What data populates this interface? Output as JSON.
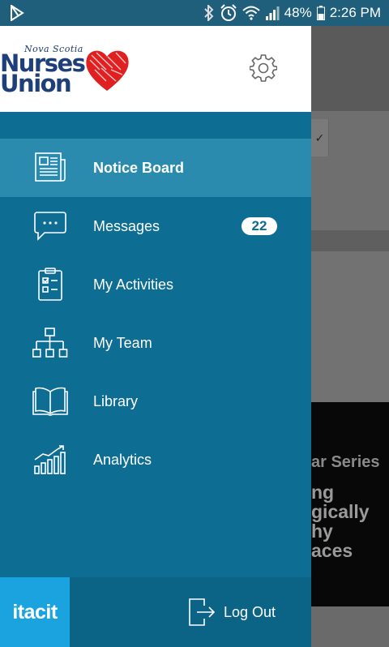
{
  "status_bar": {
    "app_icon": "play-store-icon",
    "icons": [
      "bluetooth-icon",
      "alarm-icon",
      "wifi-icon",
      "signal-icon"
    ],
    "battery": "48%",
    "time": "2:26 PM"
  },
  "drawer": {
    "logo": {
      "small_text": "Nova Scotia",
      "line1": "Nurses",
      "line2": "Union"
    },
    "settings_icon": "gear-icon",
    "menu": [
      {
        "label": "Notice Board",
        "icon": "newspaper-icon",
        "active": true
      },
      {
        "label": "Messages",
        "icon": "chat-bubble-icon",
        "badge": "22"
      },
      {
        "label": "My Activities",
        "icon": "clipboard-checklist-icon"
      },
      {
        "label": "My Team",
        "icon": "org-chart-icon"
      },
      {
        "label": "Library",
        "icon": "open-book-icon"
      },
      {
        "label": "Analytics",
        "icon": "bar-chart-icon"
      }
    ],
    "footer": {
      "brand": "itacit",
      "logout_label": "Log Out",
      "logout_icon": "logout-icon"
    }
  },
  "background": {
    "banner_series": "ar Series",
    "banner_lines": [
      "ng",
      "gically",
      "hy",
      "aces"
    ]
  },
  "colors": {
    "drawer_bg": "#0e6d92",
    "active_item_bg": "#2a8bae",
    "status_bar": "#1f5f7c",
    "brand_blue": "#1aa3de",
    "logo_heart": "#e02020"
  }
}
